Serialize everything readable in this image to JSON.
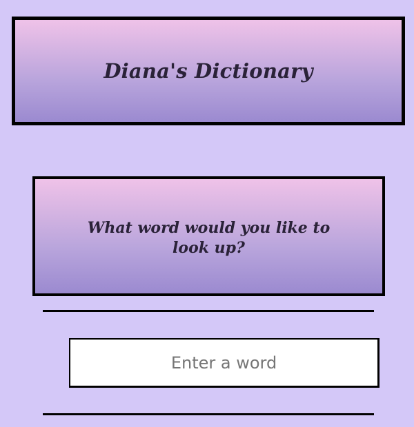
{
  "header": {
    "title": "Diana's Dictionary"
  },
  "prompt": {
    "question": "What word would you like to look up?"
  },
  "search": {
    "placeholder": "Enter a word",
    "value": ""
  },
  "colors": {
    "page_background": "#d4c8f8",
    "gradient_top": "#efc2e8",
    "gradient_bottom": "#9b8ad0",
    "border": "#000000",
    "heading_text": "#2a2238"
  }
}
